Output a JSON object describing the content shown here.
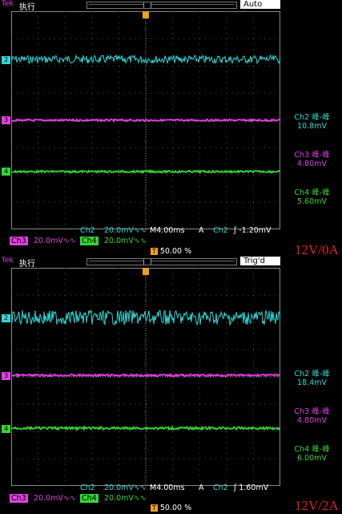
{
  "panels": [
    {
      "run_state": "Tek",
      "run_label": "执行",
      "trigger_state": "Auto",
      "channels": {
        "ch2_marker": "2",
        "ch3_marker": "3",
        "ch4_marker": "4"
      },
      "measurements": [
        {
          "title": "Ch2 峰-峰",
          "value": "10.8mV",
          "color": "#33d6d6"
        },
        {
          "title": "Ch3 峰-峰",
          "value": "4.80mV",
          "color": "#e040e0"
        },
        {
          "title": "Ch4 峰-峰",
          "value": "5.60mV",
          "color": "#34d634"
        }
      ],
      "scale_row1": {
        "ch2": "Ch2",
        "ch2_scale": "20.0mV∿∿",
        "timebase": "M4.00ms",
        "trig_mode": "A",
        "trig_src": "Ch2",
        "trig_level": "ʃ -1.20mV"
      },
      "scale_row2": {
        "ch3": "Ch3",
        "ch3_scale": "20.0mV∿∿",
        "ch4": "Ch4",
        "ch4_scale": "20.0mV∿∿"
      },
      "trigger_pos": "50.00 %",
      "condition_label": "12V/0A"
    },
    {
      "run_state": "Tek",
      "run_label": "执行",
      "trigger_state": "Trig'd",
      "channels": {
        "ch2_marker": "2",
        "ch3_marker": "3",
        "ch4_marker": "4"
      },
      "measurements": [
        {
          "title": "Ch2 峰-峰",
          "value": "18.4mV",
          "color": "#33d6d6"
        },
        {
          "title": "Ch3 峰-峰",
          "value": "4.80mV",
          "color": "#e040e0"
        },
        {
          "title": "Ch4 峰-峰",
          "value": "6.00mV",
          "color": "#34d634"
        }
      ],
      "scale_row1": {
        "ch2": "Ch2",
        "ch2_scale": "20.0mV∿∿",
        "timebase": "M4.00ms",
        "trig_mode": "A",
        "trig_src": "Ch2",
        "trig_level": "ʃ 1.60mV"
      },
      "scale_row2": {
        "ch3": "Ch3",
        "ch3_scale": "20.0mV∿∿",
        "ch4": "Ch4",
        "ch4_scale": "20.0mV∿∿"
      },
      "trigger_pos": "50.00 %",
      "condition_label": "12V/2A"
    }
  ],
  "colors": {
    "ch2": "#33d6d6",
    "ch3": "#e040e0",
    "ch4": "#34d634",
    "grid": "#555555",
    "condition": "#e3201b"
  }
}
